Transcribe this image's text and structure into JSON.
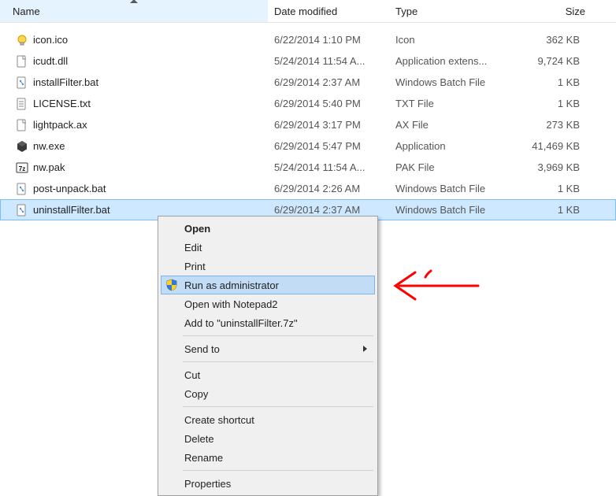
{
  "columns": {
    "name": "Name",
    "date": "Date modified",
    "type": "Type",
    "size": "Size"
  },
  "files": [
    {
      "icon": "bulb",
      "name": "icon.ico",
      "date": "6/22/2014 1:10 PM",
      "type": "Icon",
      "size": "362 KB"
    },
    {
      "icon": "generic",
      "name": "icudt.dll",
      "date": "5/24/2014 11:54 A...",
      "type": "Application extens...",
      "size": "9,724 KB"
    },
    {
      "icon": "batch",
      "name": "installFilter.bat",
      "date": "6/29/2014 2:37 AM",
      "type": "Windows Batch File",
      "size": "1 KB"
    },
    {
      "icon": "text",
      "name": "LICENSE.txt",
      "date": "6/29/2014 5:40 PM",
      "type": "TXT File",
      "size": "1 KB"
    },
    {
      "icon": "generic",
      "name": "lightpack.ax",
      "date": "6/29/2014 3:17 PM",
      "type": "AX File",
      "size": "273 KB"
    },
    {
      "icon": "nw",
      "name": "nw.exe",
      "date": "6/29/2014 5:47 PM",
      "type": "Application",
      "size": "41,469 KB"
    },
    {
      "icon": "7z",
      "name": "nw.pak",
      "date": "5/24/2014 11:54 A...",
      "type": "PAK File",
      "size": "3,969 KB"
    },
    {
      "icon": "batch",
      "name": "post-unpack.bat",
      "date": "6/29/2014 2:26 AM",
      "type": "Windows Batch File",
      "size": "1 KB"
    },
    {
      "icon": "batch",
      "name": "uninstallFilter.bat",
      "date": "6/29/2014 2:37 AM",
      "type": "Windows Batch File",
      "size": "1 KB",
      "selected": true
    }
  ],
  "context_menu": [
    {
      "kind": "item",
      "label": "Open",
      "bold": true
    },
    {
      "kind": "item",
      "label": "Edit"
    },
    {
      "kind": "item",
      "label": "Print"
    },
    {
      "kind": "item",
      "label": "Run as administrator",
      "icon": "shield",
      "highlight": true
    },
    {
      "kind": "item",
      "label": "Open with Notepad2"
    },
    {
      "kind": "item",
      "label": "Add to \"uninstallFilter.7z\""
    },
    {
      "kind": "sep"
    },
    {
      "kind": "item",
      "label": "Send to",
      "submenu": true
    },
    {
      "kind": "sep"
    },
    {
      "kind": "item",
      "label": "Cut"
    },
    {
      "kind": "item",
      "label": "Copy"
    },
    {
      "kind": "sep"
    },
    {
      "kind": "item",
      "label": "Create shortcut"
    },
    {
      "kind": "item",
      "label": "Delete"
    },
    {
      "kind": "item",
      "label": "Rename"
    },
    {
      "kind": "sep"
    },
    {
      "kind": "item",
      "label": "Properties"
    }
  ],
  "iconset": {
    "bulb": "bulb-icon",
    "generic": "generic-file-icon",
    "batch": "batch-file-icon",
    "text": "text-file-icon",
    "nw": "nw-app-icon",
    "7z": "sevenzip-icon",
    "shield": "uac-shield-icon"
  }
}
